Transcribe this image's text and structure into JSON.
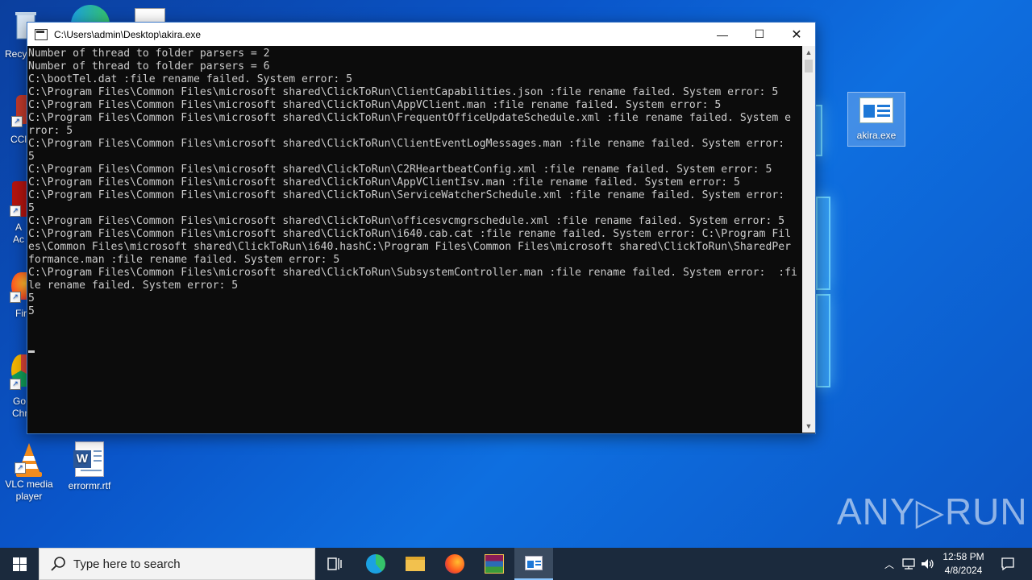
{
  "window": {
    "title": "C:\\Users\\admin\\Desktop\\akira.exe",
    "minimize": "—",
    "maximize": "☐",
    "close": "✕"
  },
  "console": {
    "text": "Number of thread to folder parsers = 2\nNumber of thread to folder parsers = 6\nC:\\bootTel.dat :file rename failed. System error: 5\nC:\\Program Files\\Common Files\\microsoft shared\\ClickToRun\\ClientCapabilities.json :file rename failed. System error: 5\nC:\\Program Files\\Common Files\\microsoft shared\\ClickToRun\\AppVClient.man :file rename failed. System error: 5\nC:\\Program Files\\Common Files\\microsoft shared\\ClickToRun\\FrequentOfficeUpdateSchedule.xml :file rename failed. System e\nrror: 5\nC:\\Program Files\\Common Files\\microsoft shared\\ClickToRun\\ClientEventLogMessages.man :file rename failed. System error:\n5\nC:\\Program Files\\Common Files\\microsoft shared\\ClickToRun\\C2RHeartbeatConfig.xml :file rename failed. System error: 5\nC:\\Program Files\\Common Files\\microsoft shared\\ClickToRun\\AppVClientIsv.man :file rename failed. System error: 5\nC:\\Program Files\\Common Files\\microsoft shared\\ClickToRun\\ServiceWatcherSchedule.xml :file rename failed. System error:\n5\nC:\\Program Files\\Common Files\\microsoft shared\\ClickToRun\\officesvcmgrschedule.xml :file rename failed. System error: 5\nC:\\Program Files\\Common Files\\microsoft shared\\ClickToRun\\i640.cab.cat :file rename failed. System error: C:\\Program Fil\nes\\Common Files\\microsoft shared\\ClickToRun\\i640.hashC:\\Program Files\\Common Files\\microsoft shared\\ClickToRun\\SharedPer\nformance.man :file rename failed. System error: 5\nC:\\Program Files\\Common Files\\microsoft shared\\ClickToRun\\SubsystemController.man :file rename failed. System error:  :fi\nle rename failed. System error: 5\n5\n5"
  },
  "desktop": {
    "icons": [
      {
        "label": "akira.exe"
      },
      {
        "label": "VLC media player"
      },
      {
        "label": "errormr.rtf"
      }
    ],
    "partial_labels": [
      "Recy",
      "CCl",
      "A",
      "Ac",
      "Fir",
      "Go",
      "Chr"
    ]
  },
  "taskbar": {
    "search_placeholder": "Type here to search",
    "time": "12:58 PM",
    "date": "4/8/2024",
    "apps": [
      "task-view",
      "edge",
      "file-explorer",
      "firefox",
      "winrar",
      "console"
    ]
  },
  "watermark": "ANY▷RUN",
  "colors": {
    "console_bg": "#0c0c0c",
    "console_fg": "#cccccc",
    "desktop_accent": "#0a55c9",
    "taskbar": "#1b2a3d"
  }
}
